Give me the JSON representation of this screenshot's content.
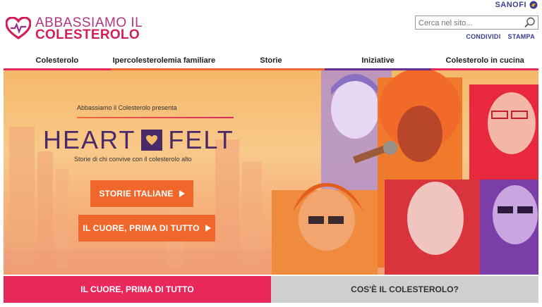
{
  "brand": {
    "line1": "ABBASSIAMO IL",
    "line2": "COLESTEROLO",
    "sponsor": "SANOFI"
  },
  "search": {
    "placeholder": "Cerca nel sito..."
  },
  "tools": {
    "share": "CONDIVIDI",
    "print": "STAMPA"
  },
  "nav": {
    "items": [
      {
        "label": "Colesterolo",
        "color": "#e8285a"
      },
      {
        "label": "Ipercolesterolemia familiare",
        "color": "#f0672b"
      },
      {
        "label": "Storie",
        "color": "#f0672b"
      },
      {
        "label": "Iniziative",
        "color": "#6b2c91"
      },
      {
        "label": "Colesterolo in cucina",
        "color": "#e8285a"
      }
    ]
  },
  "hero": {
    "presenta": "Abbassiamo il Colesterolo presenta",
    "title_left": "HEART",
    "title_right": "FELT",
    "subtitle": "Storie di chi convive con il colesterolo alto",
    "button1": "STORIE ITALIANE",
    "button2": "IL CUORE, PRIMA DI TUTTO"
  },
  "tabs": {
    "left": "IL CUORE, PRIMA DI TUTTO",
    "right": "COS'È IL COLESTEROLO?"
  },
  "colors": {
    "accent_pink": "#e8285a",
    "accent_orange": "#f0672b",
    "accent_purple": "#6b2c91",
    "title_purple": "#4a2a67"
  },
  "icons": {
    "logo": "heart-logo-icon",
    "search": "magnifier-icon",
    "arrow": "triangle-right-icon"
  }
}
